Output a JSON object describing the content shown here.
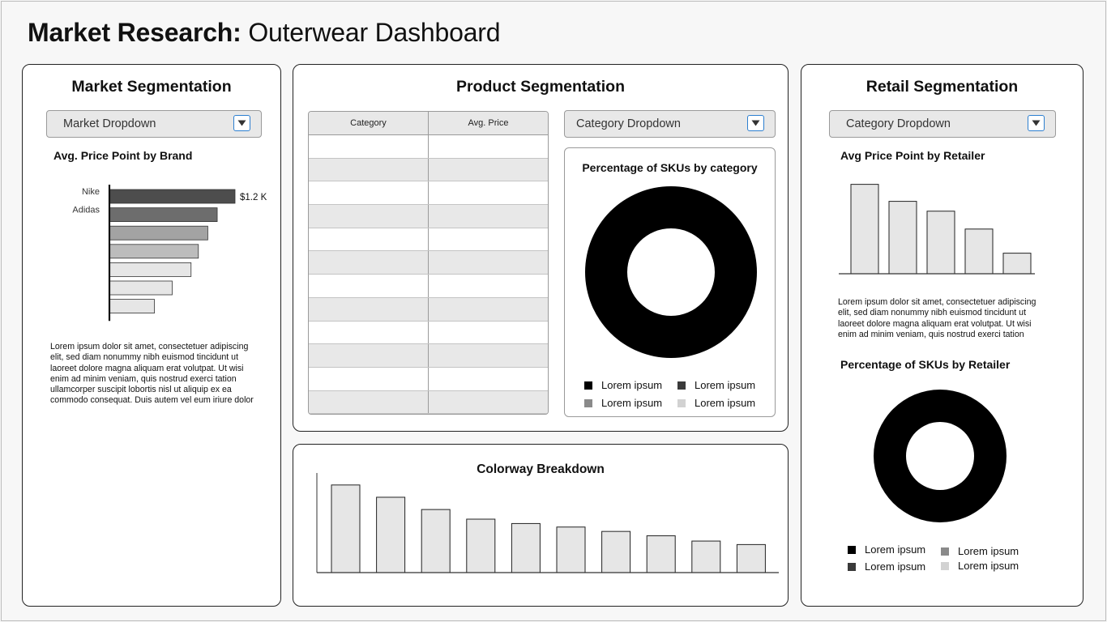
{
  "page": {
    "title_bold": "Market Research",
    "title_colon": ":",
    "title_rest": " Outerwear Dashboard"
  },
  "market": {
    "title": "Market Segmentation",
    "dropdown_label": "Market Dropdown",
    "chart_title": "Avg. Price Point by Brand",
    "text": "Lorem ipsum dolor sit amet, consectetuer adipiscing elit, sed diam nonummy nibh euismod tincidunt ut laoreet dolore magna aliquam erat volutpat. Ut wisi enim ad minim veniam, quis nostrud exerci tation ullamcorper suscipit lobortis nisl ut aliquip ex ea commodo consequat. Duis autem vel eum iriure dolor"
  },
  "product": {
    "title": "Product Segmentation",
    "table_headers": [
      "Category",
      "Avg. Price"
    ],
    "table_row_count": 12,
    "dropdown_label": "Category Dropdown",
    "donut_title": "Percentage of SKUs by category",
    "legend": [
      {
        "label": "Lorem ipsum",
        "color": "#000000"
      },
      {
        "label": "Lorem ipsum",
        "color": "#3a3a3a"
      },
      {
        "label": "Lorem ipsum",
        "color": "#8a8a8a"
      },
      {
        "label": "Lorem ipsum",
        "color": "#d2d2d2"
      }
    ]
  },
  "colorway": {
    "title": "Colorway Breakdown"
  },
  "retail": {
    "title": "Retail Segmentation",
    "dropdown_label": "Category Dropdown",
    "chart_title": "Avg Price Point by Retailer",
    "text": "Lorem ipsum dolor sit amet, consectetuer adipiscing elit, sed diam nonummy nibh euismod tincidunt ut laoreet dolore magna aliquam erat volutpat. Ut wisi enim ad minim veniam, quis nostrud exerci tation",
    "donut_title": "Percentage of SKUs by Retailer",
    "legend": [
      {
        "label": "Lorem ipsum",
        "color": "#000000"
      },
      {
        "label": "Lorem ipsum",
        "color": "#8a8a8a"
      },
      {
        "label": "Lorem ipsum",
        "color": "#3a3a3a"
      },
      {
        "label": "Lorem ipsum",
        "color": "#d2d2d2"
      }
    ]
  },
  "chart_data": [
    {
      "id": "brand",
      "type": "bar",
      "orientation": "horizontal",
      "title": "Avg. Price Point by Brand",
      "categories": [
        "Nike",
        "Adidas",
        "",
        "",
        "",
        "",
        ""
      ],
      "values": [
        1.2,
        1.03,
        0.94,
        0.85,
        0.78,
        0.6,
        0.43
      ],
      "colors": [
        "#4d4d4d",
        "#6d6d6d",
        "#a3a3a3",
        "#bcbcbc",
        "#e6e6e6",
        "#e6e6e6",
        "#e6e6e6"
      ],
      "data_labels": [
        "$1.2 K",
        "",
        "",
        "",
        "",
        "",
        ""
      ],
      "unit": "$K"
    },
    {
      "id": "category-donut",
      "type": "pie",
      "title": "Percentage of SKUs by category",
      "labels": [
        "Lorem ipsum"
      ],
      "values": [
        100
      ],
      "colors": [
        "#000000"
      ]
    },
    {
      "id": "colorway",
      "type": "bar",
      "title": "Colorway Breakdown",
      "values": [
        100,
        86,
        72,
        61,
        56,
        52,
        47,
        42,
        36,
        32
      ],
      "ylim": [
        0,
        110
      ]
    },
    {
      "id": "retailer",
      "type": "bar",
      "title": "Avg Price Point by Retailer",
      "values": [
        100,
        81,
        70,
        50,
        23
      ],
      "ylim": [
        0,
        106
      ]
    },
    {
      "id": "retailer-donut",
      "type": "pie",
      "title": "Percentage of SKUs by Retailer",
      "labels": [
        "Lorem ipsum"
      ],
      "values": [
        100
      ],
      "colors": [
        "#000000"
      ]
    }
  ]
}
